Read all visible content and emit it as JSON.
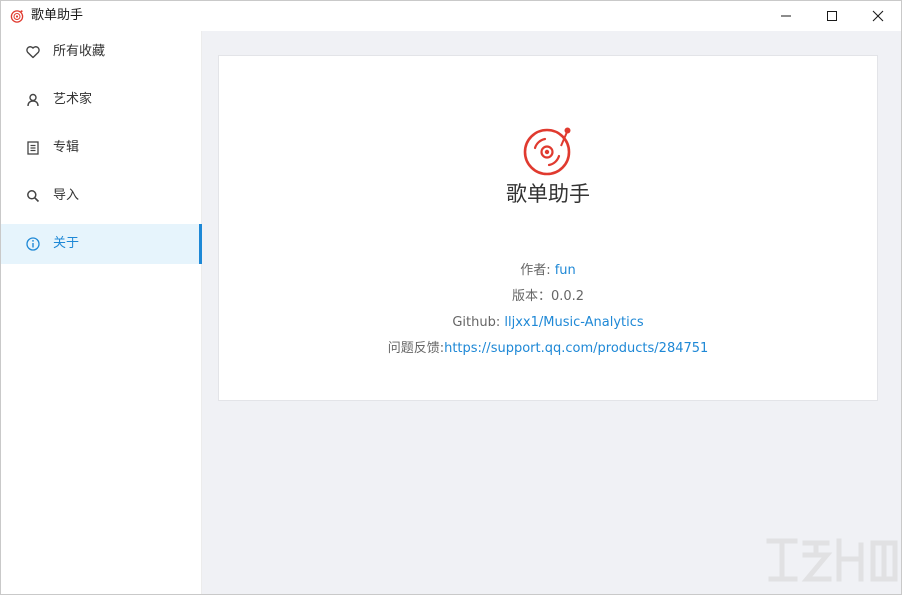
{
  "window": {
    "title": "歌单助手",
    "controls": {
      "minimize": "minimize-icon",
      "maximize": "maximize-icon",
      "close": "close-icon"
    }
  },
  "sidebar": {
    "items": [
      {
        "label": "所有收藏",
        "icon": "heart-icon"
      },
      {
        "label": "艺术家",
        "icon": "user-icon"
      },
      {
        "label": "专辑",
        "icon": "album-icon"
      },
      {
        "label": "导入",
        "icon": "search-icon"
      },
      {
        "label": "关于",
        "icon": "info-icon",
        "active": true
      }
    ]
  },
  "about": {
    "app_name": "歌单助手",
    "author_label": "作者: ",
    "author_value": "fun",
    "version_label": "版本：",
    "version_value": "0.0.2",
    "github_label": "Github: ",
    "github_value": "lljxx1/Music-Analytics",
    "feedback_label": "问题反馈:",
    "feedback_value": "https://support.qq.com/products/284751"
  },
  "colors": {
    "accent": "#1e88d6",
    "brand": "#e03a2f",
    "active_bg": "#e6f4fc",
    "content_bg": "#f0f1f5"
  }
}
